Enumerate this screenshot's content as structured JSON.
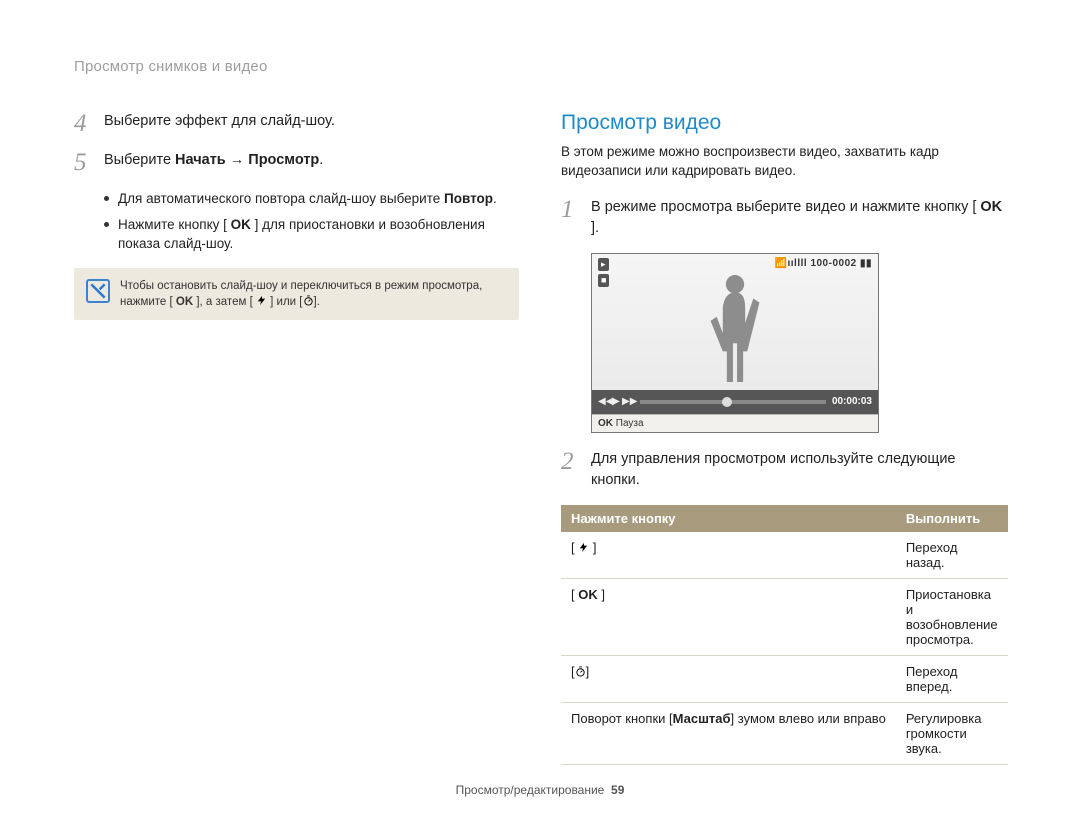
{
  "running_head": "Просмотр снимков и видео",
  "left": {
    "step4_num": "4",
    "step4_text": "Выберите эффект для слайд-шоу.",
    "step5_num": "5",
    "step5_pre": "Выберите ",
    "step5_bold": "Начать → Просмотр",
    "step5_post": ".",
    "bullet1_pre": "Для автоматического повтора слайд-шоу выберите ",
    "bullet1_bold": "Повтор",
    "bullet1_post": ".",
    "bullet2_pre": "Нажмите кнопку [ ",
    "bullet2_ok": "OK",
    "bullet2_post": " ] для приостановки и возобновления показа слайд-шоу.",
    "note_pre": "Чтобы остановить слайд-шоу и переключиться в режим просмотра, нажмите [ ",
    "note_ok": "OK",
    "note_mid": " ], а затем [ ",
    "note_or": " ] или [",
    "note_end": "].",
    "note_icon": "flash",
    "note_icon2": "timer"
  },
  "right": {
    "heading": "Просмотр видео",
    "intro": "В этом режиме можно воспроизвести видео, захватить кадр видеозаписи или кадрировать видео.",
    "step1_num": "1",
    "step1_pre": "В режиме просмотра выберите видео и нажмите кнопку [ ",
    "step1_ok": "OK",
    "step1_post": " ].",
    "screen": {
      "topright": "100-0002",
      "time": "00:00:03",
      "caption_ok": "OK",
      "caption_text": "Пауза"
    },
    "step2_num": "2",
    "step2_text": "Для управления просмотром используйте следующие кнопки.",
    "table": {
      "h1": "Нажмите кнопку",
      "h2": "Выполнить",
      "rows": [
        {
          "btn_kind": "flash",
          "btn_text": "",
          "desc": "Переход назад."
        },
        {
          "btn_kind": "ok",
          "btn_text": "OK",
          "desc": "Приостановка и возобновление просмотра."
        },
        {
          "btn_kind": "timer",
          "btn_text": "",
          "desc": "Переход вперед."
        },
        {
          "btn_kind": "text",
          "btn_pre": "Поворот кнопки [",
          "btn_bold": "Масштаб",
          "btn_post": "] зумом влево или вправо",
          "desc": "Регулировка громкости звука."
        }
      ]
    }
  },
  "footer": {
    "section": "Просмотр/редактирование",
    "page": "59"
  }
}
